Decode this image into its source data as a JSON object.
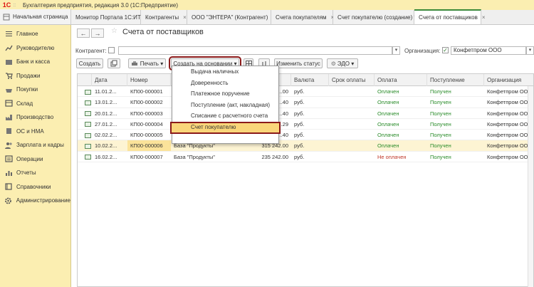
{
  "window": {
    "title": "Бухгалтерия предприятия, редакция 3.0  (1С:Предприятие)",
    "logo": "1С",
    "logo_sep": "::"
  },
  "tabs": {
    "home": "Начальная страница",
    "items": [
      {
        "label": "Монитор Портала 1С:ИТС",
        "close": "×"
      },
      {
        "label": "Контрагенты",
        "close": "×"
      },
      {
        "label": "ООО \"ЭНТЕРА\" (Контрагент)",
        "close": "×"
      },
      {
        "label": "Счета покупателям",
        "close": "×"
      },
      {
        "label": "Счет покупателю (создание) *",
        "close": "×"
      },
      {
        "label": "Счета от поставщиков",
        "close": "×"
      }
    ]
  },
  "sidebar": {
    "items": [
      {
        "label": "Главное",
        "icon": "menu-icon"
      },
      {
        "label": "Руководителю",
        "icon": "chart-icon"
      },
      {
        "label": "Банк и касса",
        "icon": "bank-icon"
      },
      {
        "label": "Продажи",
        "icon": "cart-icon"
      },
      {
        "label": "Покупки",
        "icon": "basket-icon"
      },
      {
        "label": "Склад",
        "icon": "box-icon"
      },
      {
        "label": "Производство",
        "icon": "factory-icon"
      },
      {
        "label": "ОС и НМА",
        "icon": "building-icon"
      },
      {
        "label": "Зарплата и кадры",
        "icon": "people-icon"
      },
      {
        "label": "Операции",
        "icon": "operations-icon"
      },
      {
        "label": "Отчеты",
        "icon": "report-icon"
      },
      {
        "label": "Справочники",
        "icon": "book-icon"
      },
      {
        "label": "Администрирование",
        "icon": "gear-icon"
      }
    ]
  },
  "page": {
    "title": "Счета от поставщиков",
    "nav_back": "←",
    "nav_forward": "→",
    "star": "☆"
  },
  "filters": {
    "contractor_label": "Контрагент:",
    "contractor_value": "",
    "org_label": "Организация:",
    "org_value": "Конфетпром ООО"
  },
  "toolbar": {
    "create": "Создать",
    "print": "Печать ▾",
    "create_based": "Создать на основании ▾",
    "change_status": "Изменить статус",
    "edo": "ЭДО ▾"
  },
  "dropdown": {
    "items": [
      "Выдача наличных",
      "Доверенность",
      "Платежное поручение",
      "Поступление (акт, накладная)",
      "Списание с расчетного счета",
      "Счет покупателю"
    ],
    "highlighted_index": 5
  },
  "table": {
    "columns": [
      "Дата",
      "Номер",
      "",
      "",
      "Валюта",
      "Срок оплаты",
      "Оплата",
      "Поступление",
      "Организация"
    ],
    "rows": [
      {
        "date": "11.01.2...",
        "num": "КП00-000001",
        "contractor": "",
        "sum": "...00",
        "cur": "руб.",
        "due": "",
        "pay": "Оплачен",
        "recv": "Получен",
        "org": "Конфетпром ООО"
      },
      {
        "date": "13.01.2...",
        "num": "КП00-000002",
        "contractor": "",
        "sum": "...40",
        "cur": "руб.",
        "due": "",
        "pay": "Оплачен",
        "recv": "Получен",
        "org": "Конфетпром ООО"
      },
      {
        "date": "20.01.2...",
        "num": "КП00-000003",
        "contractor": "",
        "sum": "...40",
        "cur": "руб.",
        "due": "",
        "pay": "Оплачен",
        "recv": "Получен",
        "org": "Конфетпром ООО"
      },
      {
        "date": "27.01.2...",
        "num": "КП00-000004",
        "contractor": "",
        "sum": "...29",
        "cur": "руб.",
        "due": "",
        "pay": "Оплачен",
        "recv": "Получен",
        "org": "Конфетпром ООО"
      },
      {
        "date": "02.02.2...",
        "num": "КП00-000005",
        "contractor": "",
        "sum": "...40",
        "cur": "руб.",
        "due": "",
        "pay": "Оплачен",
        "recv": "Получен",
        "org": "Конфетпром ООО"
      },
      {
        "date": "10.02.2...",
        "num": "КП00-000006",
        "contractor": "База \"Продукты\"",
        "sum": "315 242.00",
        "cur": "руб.",
        "due": "",
        "pay": "Оплачен",
        "recv": "Получен",
        "org": "Конфетпром ООО"
      },
      {
        "date": "16.02.2...",
        "num": "КП00-000007",
        "contractor": "База \"Продукты\"",
        "sum": "235 242.00",
        "cur": "руб.",
        "due": "",
        "pay": "Не оплачен",
        "recv": "Получен",
        "org": "Конфетпром ООО"
      }
    ],
    "selected_index": 5
  }
}
